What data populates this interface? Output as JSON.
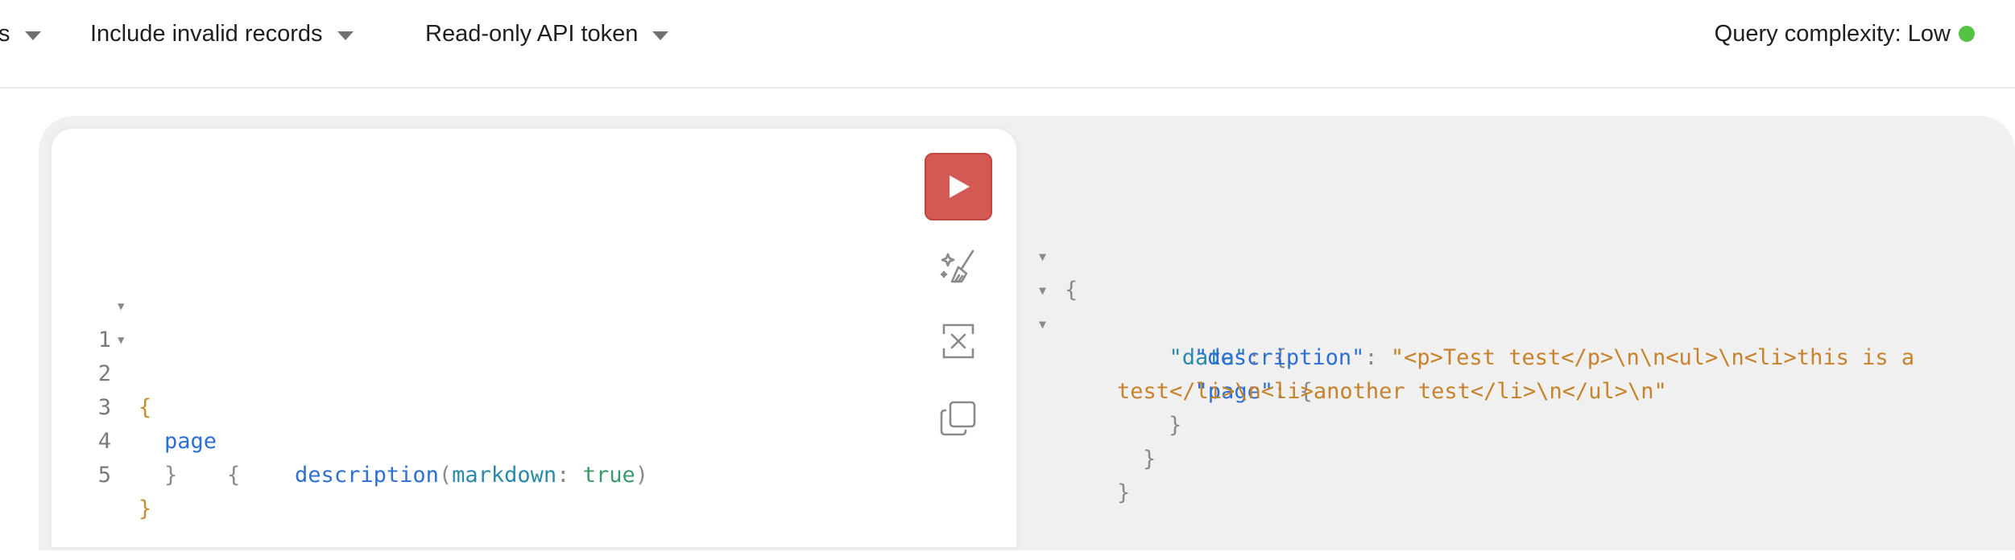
{
  "toolbar": {
    "cut_item_label": "s",
    "invalid_records_label": "Include invalid records",
    "token_label": "Read-only API token",
    "complexity_label": "Query complexity: Low",
    "complexity_color": "#54c242"
  },
  "editor": {
    "line_numbers": [
      "1",
      "2",
      "3",
      "4",
      "5"
    ],
    "lines": {
      "l1_open": "{",
      "l2_field": "page",
      "l2_open": "{",
      "l3_field": "description",
      "l3_paren_open": "(",
      "l3_arg": "markdown",
      "l3_colon": ":",
      "l3_value": "true",
      "l3_paren_close": ")",
      "l4_close": "}",
      "l5_close": "}"
    }
  },
  "tools": {
    "run_icon": "play-icon",
    "prettify_icon": "magic-brush-icon",
    "merge_icon": "merge-fragments-icon",
    "copy_icon": "copy-icon",
    "run_color": "#d35a52"
  },
  "result": {
    "open_brace": "{",
    "data_key": "\"data\"",
    "page_key": "\"page\"",
    "description_key": "\"description\"",
    "colon": ":",
    "brace": "{",
    "description_value_line1": "\"<p>Test test</p>\\n\\n<ul>\\n<li>this is a",
    "description_value_line2": "test</li>\\n<li>another test</li>\\n</ul>\\n\"",
    "close_brace": "}"
  }
}
